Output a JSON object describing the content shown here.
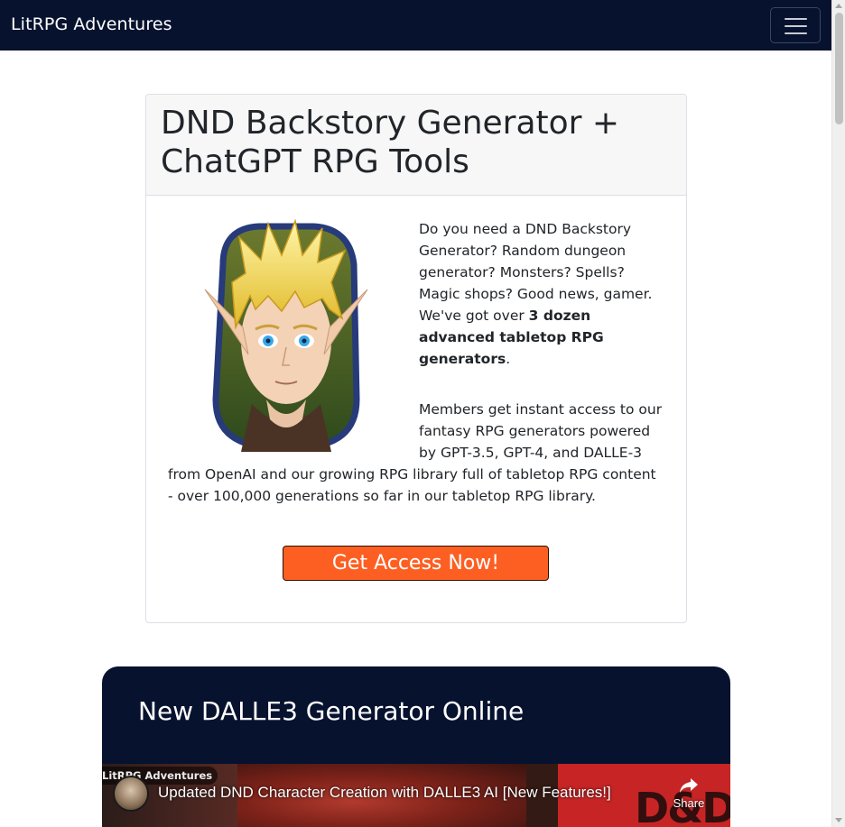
{
  "navbar": {
    "brand": "LitRPG Adventures",
    "toggler_icon": "hamburger-menu-icon"
  },
  "card": {
    "title": "DND Backstory Generator + ChatGPT RPG Tools",
    "portrait_icon": "elf-portrait-image",
    "intro_text": "Do you need a DND Backstory Generator? Random dungeon generator? Monsters? Spells? Magic shops? Good news, gamer. We've got over ",
    "intro_bold": "3 dozen advanced tabletop RPG generators",
    "intro_end": ".",
    "members_text": "Members get instant access to our fantasy RPG generators powered by GPT-3.5, GPT-4, and DALLE-3 from OpenAI and our growing RPG library full of tabletop RPG content - over 100,000 generations so far in our tabletop RPG library.",
    "cta_label": "Get Access Now!"
  },
  "promo": {
    "title": "New DALLE3 Generator Online",
    "video": {
      "channel": "LitRPG Adventures",
      "title": "Updated DND Character Creation with DALLE3 AI [New Features!]",
      "share_label": "Share",
      "thumbnail_text": "D&D+AI"
    }
  },
  "colors": {
    "navbar_bg": "#07122f",
    "cta_bg": "#fd5f22",
    "promo_bg": "#07122f"
  }
}
